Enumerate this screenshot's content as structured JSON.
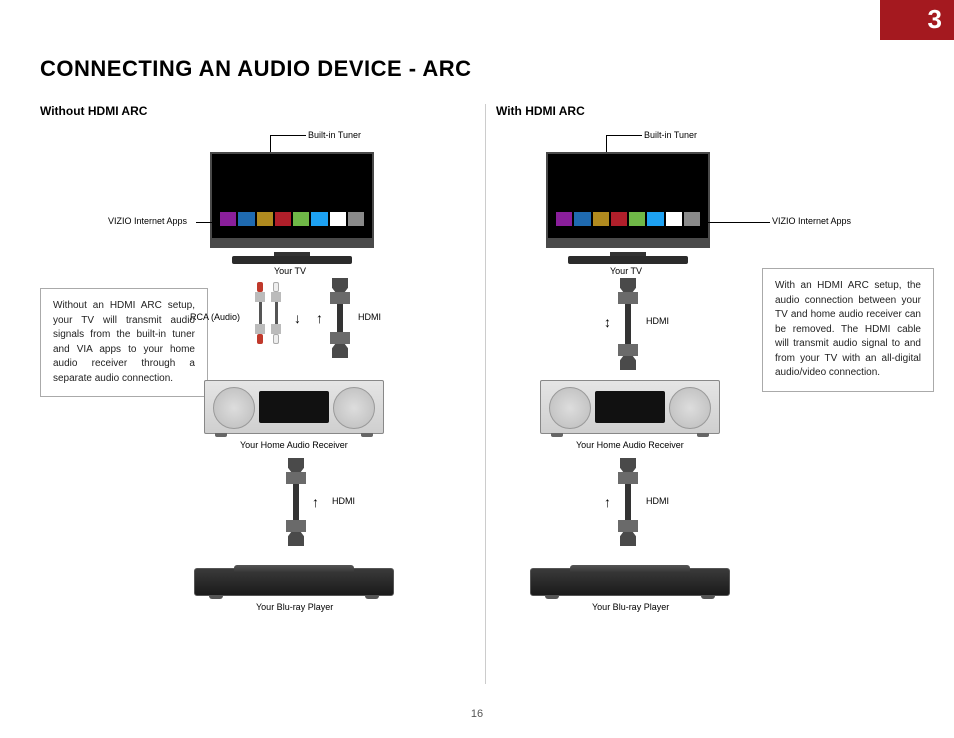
{
  "chapter_number": "3",
  "page_number": "16",
  "title": "CONNECTING AN AUDIO DEVICE - ARC",
  "left": {
    "subhead": "Without HDMI ARC",
    "builtin_tuner": "Built-in Tuner",
    "vizio_apps": "VIZIO Internet  Apps",
    "your_tv": "Your TV",
    "rca_label": "RCA (Audio)",
    "hdmi_label_1": "HDMI",
    "receiver_label": "Your Home Audio Receiver",
    "hdmi_label_2": "HDMI",
    "bluray_label": "Your Blu-ray Player",
    "note": "Without an HDMI ARC setup, your TV will transmit audio signals from the built-in tuner and VIA apps to your home audio receiver through a separate audio connection."
  },
  "right": {
    "subhead": "With HDMI ARC",
    "builtin_tuner": "Built-in Tuner",
    "vizio_apps": "VIZIO Internet  Apps",
    "your_tv": "Your TV",
    "hdmi_label_1": "HDMI",
    "receiver_label": "Your Home Audio Receiver",
    "hdmi_label_2": "HDMI",
    "bluray_label": "Your Blu-ray Player",
    "note": "With an HDMI ARC setup, the audio connection between your TV and home audio receiver can be removed. The HDMI cable will transmit audio signal to and from your TV with an all-digital audio/video connection."
  },
  "app_colors": [
    "#8a1f9b",
    "#1f6ab0",
    "#b08a1f",
    "#b01f2a",
    "#6fb847",
    "#1da1f2",
    "#cc181e",
    "#8a8a8a"
  ]
}
